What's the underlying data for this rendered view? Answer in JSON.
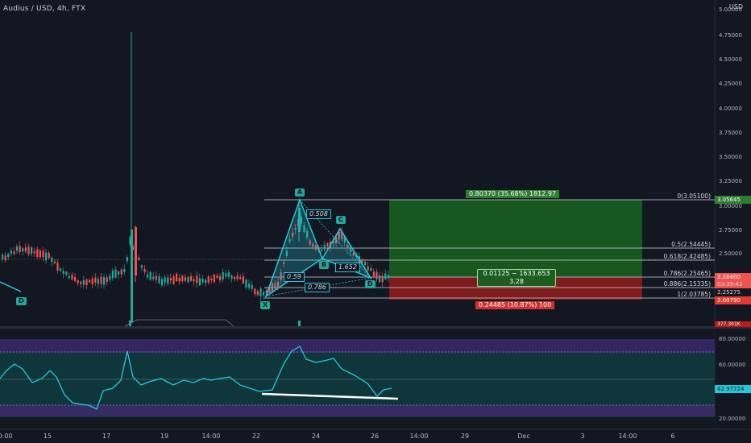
{
  "header": {
    "title": "Audius / USD, 4h, FTX",
    "currency": "USD"
  },
  "price_axis": {
    "labels": [
      "5.00000",
      "4.75000",
      "4.50000",
      "4.25000",
      "4.00000",
      "3.75000",
      "3.50000",
      "3.25000",
      "3.00000",
      "2.75000",
      "2.50000"
    ],
    "tags": {
      "target": "3.05645",
      "current": "2.26400",
      "countdown": "03:39:43",
      "level2": "2.25275",
      "stop": "2.00790",
      "volume": "377.301K"
    },
    "colors": {
      "target": "#2e7d32",
      "current": "#ef5350",
      "stop": "#e53935",
      "osc": "#26c6da"
    }
  },
  "oscillator_axis": {
    "labels": [
      "80.00000",
      "60.00000",
      "20.00000"
    ],
    "tag": "42.97724"
  },
  "time_axis": {
    "labels": [
      "10:00",
      "15",
      "17",
      "19",
      "14:00",
      "22",
      "24",
      "26",
      "14:00",
      "29",
      "Dec",
      "3",
      "14:00",
      "6"
    ]
  },
  "fib_levels": [
    "0(3.05100)",
    "0.5(2.54445)",
    "0.618(2.42485)",
    "0.786(2.25465)",
    "0.886(2.15335)",
    "1(2.03785)"
  ],
  "pattern": {
    "points": [
      "X",
      "A",
      "B",
      "C",
      "D"
    ],
    "left_point": "D",
    "ratios": [
      "0.508",
      "0.59",
      "0.786",
      "1.652"
    ]
  },
  "position_tool": {
    "profit_text": "0.80370 (35.68%) 1812.97",
    "mid_text_1": "0.01125 ~ 1633.653",
    "mid_text_2": "3.28",
    "loss_text": "0.24485 (10.87%) 100"
  }
}
